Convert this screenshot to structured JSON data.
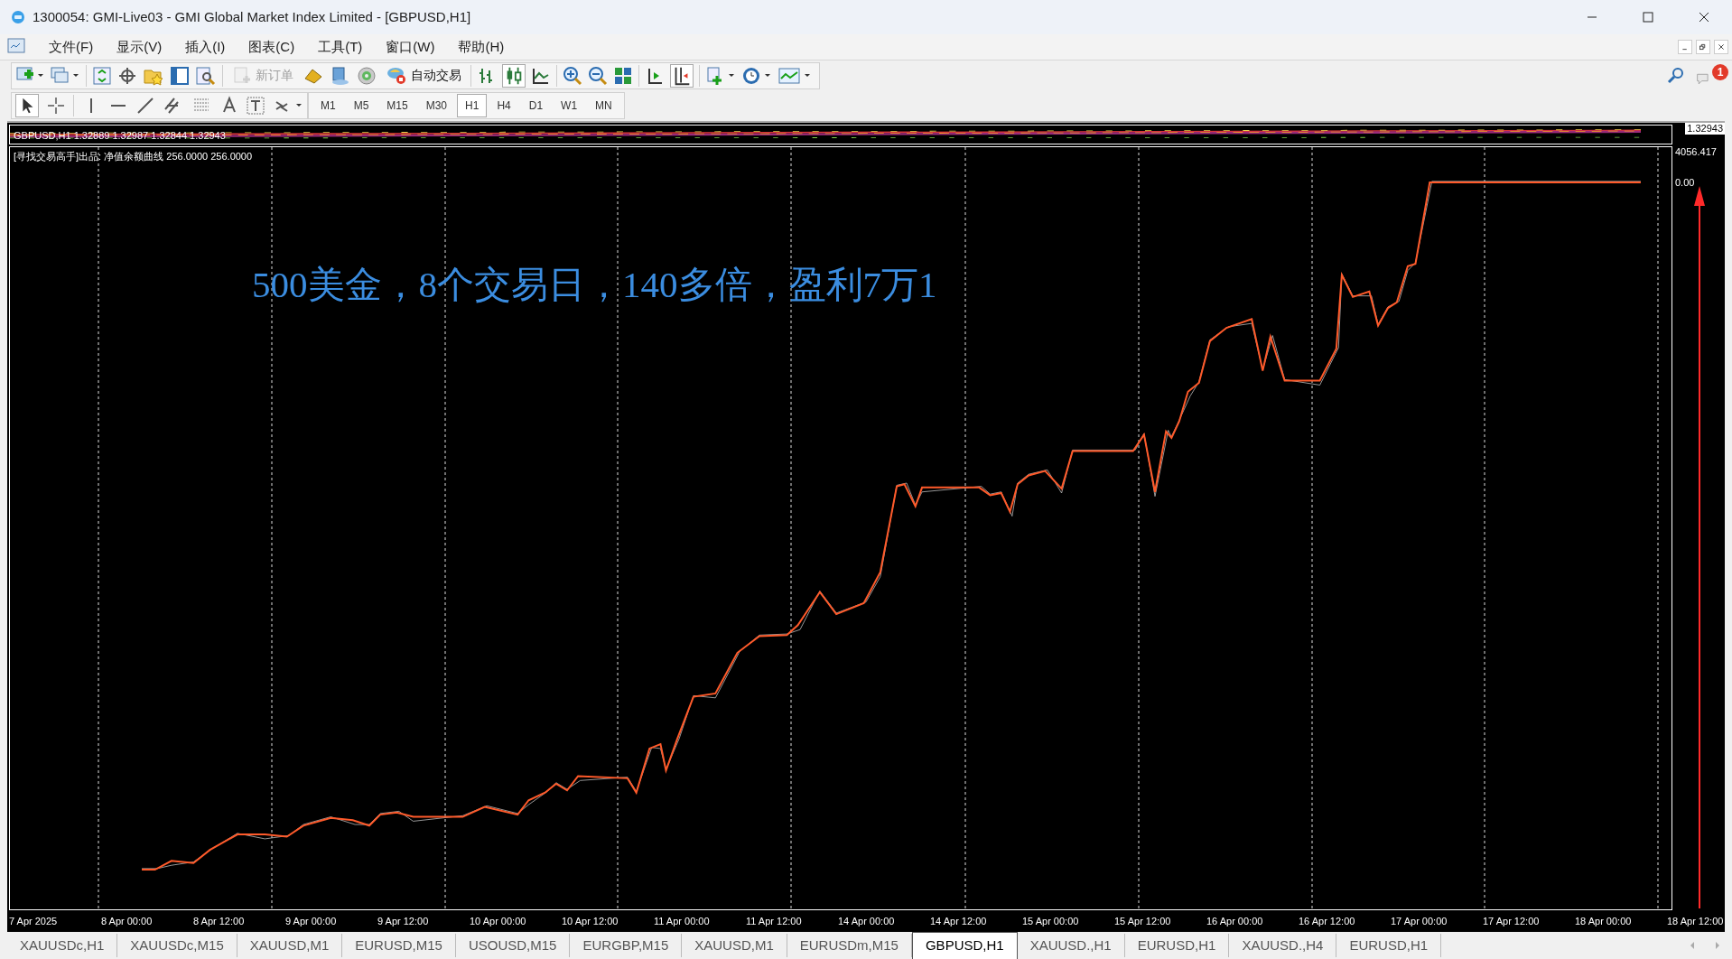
{
  "window": {
    "title": "1300054: GMI-Live03 - GMI Global Market Index Limited - [GBPUSD,H1]"
  },
  "menu": [
    "文件(F)",
    "显示(V)",
    "插入(I)",
    "图表(C)",
    "工具(T)",
    "窗口(W)",
    "帮助(H)"
  ],
  "toolbar": {
    "new_order": {
      "label": "新订单",
      "disabled": true
    },
    "auto_trading": {
      "label": "自动交易",
      "disabled": false
    },
    "notifications": "1"
  },
  "timeframes": [
    {
      "label": "M1",
      "selected": false
    },
    {
      "label": "M5",
      "selected": false
    },
    {
      "label": "M15",
      "selected": false
    },
    {
      "label": "M30",
      "selected": false
    },
    {
      "label": "H1",
      "selected": true
    },
    {
      "label": "H4",
      "selected": false
    },
    {
      "label": "D1",
      "selected": false
    },
    {
      "label": "W1",
      "selected": false
    },
    {
      "label": "MN",
      "selected": false
    }
  ],
  "chart": {
    "symbol_header": "GBPUSD,H1  1.32889 1.32987 1.32844 1.32943",
    "price_label": "1.32943",
    "indicator_label": "[寻找交易高手]出品: 净值余额曲线 256.0000 256.0000",
    "annotation": "500美金，8个交易日，140多倍，盈利7万1",
    "price_axis": [
      "4056.417",
      "0.00"
    ],
    "time_axis": [
      "7 Apr 2025",
      "8 Apr 00:00",
      "8 Apr 12:00",
      "9 Apr 00:00",
      "9 Apr 12:00",
      "10 Apr 00:00",
      "10 Apr 12:00",
      "11 Apr 00:00",
      "11 Apr 12:00",
      "14 Apr 00:00",
      "14 Apr 12:00",
      "15 Apr 00:00",
      "15 Apr 12:00",
      "16 Apr 00:00",
      "16 Apr 12:00",
      "17 Apr 00:00",
      "17 Apr 12:00",
      "18 Apr 00:00",
      "18 Apr 12:00"
    ]
  },
  "tabs": [
    {
      "label": "XAUUSDc,H1",
      "selected": false
    },
    {
      "label": "XAUUSDc,M15",
      "selected": false
    },
    {
      "label": "XAUUSD,M1",
      "selected": false
    },
    {
      "label": "EURUSD,M15",
      "selected": false
    },
    {
      "label": "USOUSD,M15",
      "selected": false
    },
    {
      "label": "EURGBP,M15",
      "selected": false
    },
    {
      "label": "XAUUSD,M1",
      "selected": false
    },
    {
      "label": "EURUSDm,M15",
      "selected": false
    },
    {
      "label": "GBPUSD,H1",
      "selected": true
    },
    {
      "label": "XAUUSD.,H1",
      "selected": false
    },
    {
      "label": "EURUSD,H1",
      "selected": false
    },
    {
      "label": "XAUUSD.,H4",
      "selected": false
    },
    {
      "label": "EURUSD,H1",
      "selected": false
    }
  ]
}
